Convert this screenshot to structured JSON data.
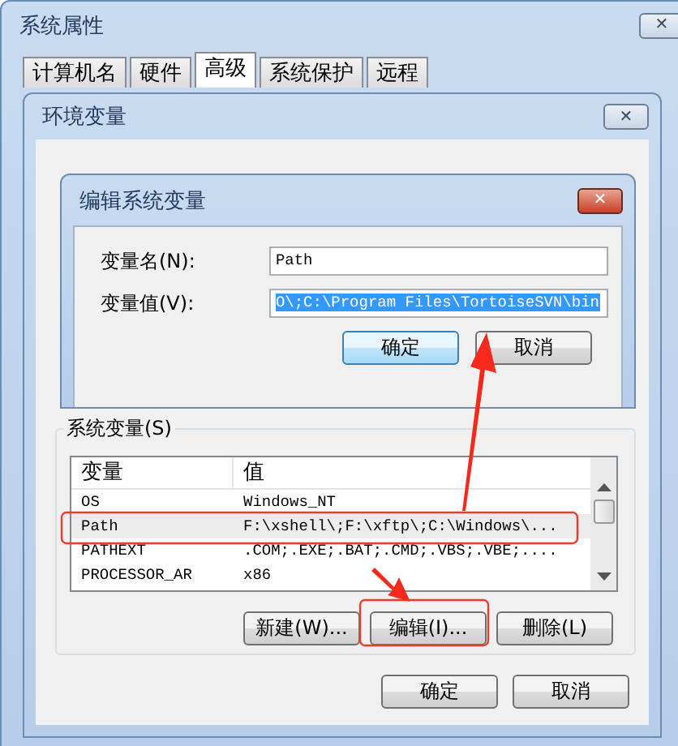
{
  "outer_window": {
    "title": "系统属性",
    "close": "✕",
    "tabs": [
      {
        "label": "计算机名",
        "selected": false
      },
      {
        "label": "硬件",
        "selected": false
      },
      {
        "label": "高级",
        "selected": true
      },
      {
        "label": "系统保护",
        "selected": false
      },
      {
        "label": "远程",
        "selected": false
      }
    ]
  },
  "env_window": {
    "title": "环境变量",
    "close": "✕",
    "system_variables": {
      "label": "系统变量(S)",
      "columns": [
        "变量",
        "值"
      ],
      "rows": [
        {
          "name": "OS",
          "value": "Windows_NT",
          "selected": false
        },
        {
          "name": "Path",
          "value": "F:\\xshell\\;F:\\xftp\\;C:\\Windows\\...",
          "selected": true
        },
        {
          "name": "PATHEXT",
          "value": ".COM;.EXE;.BAT;.CMD;.VBS;.VBE;....",
          "selected": false
        },
        {
          "name": "PROCESSOR_AR",
          "value": "x86",
          "selected": false
        }
      ],
      "buttons": [
        "新建(W)...",
        "编辑(I)...",
        "删除(L)"
      ]
    },
    "buttons": [
      "确定",
      "取消"
    ]
  },
  "edit_dialog": {
    "title": "编辑系统变量",
    "close": "✕",
    "fields": [
      {
        "label": "变量名(N):",
        "value": "Path",
        "selected": false
      },
      {
        "label": "变量值(V):",
        "value": "O\\;C:\\Program Files\\TortoiseSVN\\bin",
        "selected": true
      }
    ],
    "buttons": [
      "确定",
      "取消"
    ]
  }
}
